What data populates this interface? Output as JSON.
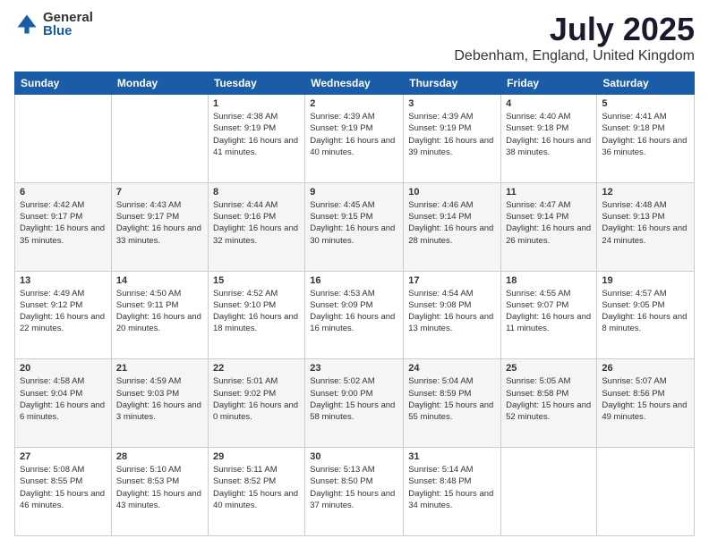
{
  "logo": {
    "general": "General",
    "blue": "Blue"
  },
  "title": {
    "month": "July 2025",
    "location": "Debenham, England, United Kingdom"
  },
  "headers": [
    "Sunday",
    "Monday",
    "Tuesday",
    "Wednesday",
    "Thursday",
    "Friday",
    "Saturday"
  ],
  "weeks": [
    [
      {
        "day": "",
        "sunrise": "",
        "sunset": "",
        "daylight": ""
      },
      {
        "day": "",
        "sunrise": "",
        "sunset": "",
        "daylight": ""
      },
      {
        "day": "1",
        "sunrise": "Sunrise: 4:38 AM",
        "sunset": "Sunset: 9:19 PM",
        "daylight": "Daylight: 16 hours and 41 minutes."
      },
      {
        "day": "2",
        "sunrise": "Sunrise: 4:39 AM",
        "sunset": "Sunset: 9:19 PM",
        "daylight": "Daylight: 16 hours and 40 minutes."
      },
      {
        "day": "3",
        "sunrise": "Sunrise: 4:39 AM",
        "sunset": "Sunset: 9:19 PM",
        "daylight": "Daylight: 16 hours and 39 minutes."
      },
      {
        "day": "4",
        "sunrise": "Sunrise: 4:40 AM",
        "sunset": "Sunset: 9:18 PM",
        "daylight": "Daylight: 16 hours and 38 minutes."
      },
      {
        "day": "5",
        "sunrise": "Sunrise: 4:41 AM",
        "sunset": "Sunset: 9:18 PM",
        "daylight": "Daylight: 16 hours and 36 minutes."
      }
    ],
    [
      {
        "day": "6",
        "sunrise": "Sunrise: 4:42 AM",
        "sunset": "Sunset: 9:17 PM",
        "daylight": "Daylight: 16 hours and 35 minutes."
      },
      {
        "day": "7",
        "sunrise": "Sunrise: 4:43 AM",
        "sunset": "Sunset: 9:17 PM",
        "daylight": "Daylight: 16 hours and 33 minutes."
      },
      {
        "day": "8",
        "sunrise": "Sunrise: 4:44 AM",
        "sunset": "Sunset: 9:16 PM",
        "daylight": "Daylight: 16 hours and 32 minutes."
      },
      {
        "day": "9",
        "sunrise": "Sunrise: 4:45 AM",
        "sunset": "Sunset: 9:15 PM",
        "daylight": "Daylight: 16 hours and 30 minutes."
      },
      {
        "day": "10",
        "sunrise": "Sunrise: 4:46 AM",
        "sunset": "Sunset: 9:14 PM",
        "daylight": "Daylight: 16 hours and 28 minutes."
      },
      {
        "day": "11",
        "sunrise": "Sunrise: 4:47 AM",
        "sunset": "Sunset: 9:14 PM",
        "daylight": "Daylight: 16 hours and 26 minutes."
      },
      {
        "day": "12",
        "sunrise": "Sunrise: 4:48 AM",
        "sunset": "Sunset: 9:13 PM",
        "daylight": "Daylight: 16 hours and 24 minutes."
      }
    ],
    [
      {
        "day": "13",
        "sunrise": "Sunrise: 4:49 AM",
        "sunset": "Sunset: 9:12 PM",
        "daylight": "Daylight: 16 hours and 22 minutes."
      },
      {
        "day": "14",
        "sunrise": "Sunrise: 4:50 AM",
        "sunset": "Sunset: 9:11 PM",
        "daylight": "Daylight: 16 hours and 20 minutes."
      },
      {
        "day": "15",
        "sunrise": "Sunrise: 4:52 AM",
        "sunset": "Sunset: 9:10 PM",
        "daylight": "Daylight: 16 hours and 18 minutes."
      },
      {
        "day": "16",
        "sunrise": "Sunrise: 4:53 AM",
        "sunset": "Sunset: 9:09 PM",
        "daylight": "Daylight: 16 hours and 16 minutes."
      },
      {
        "day": "17",
        "sunrise": "Sunrise: 4:54 AM",
        "sunset": "Sunset: 9:08 PM",
        "daylight": "Daylight: 16 hours and 13 minutes."
      },
      {
        "day": "18",
        "sunrise": "Sunrise: 4:55 AM",
        "sunset": "Sunset: 9:07 PM",
        "daylight": "Daylight: 16 hours and 11 minutes."
      },
      {
        "day": "19",
        "sunrise": "Sunrise: 4:57 AM",
        "sunset": "Sunset: 9:05 PM",
        "daylight": "Daylight: 16 hours and 8 minutes."
      }
    ],
    [
      {
        "day": "20",
        "sunrise": "Sunrise: 4:58 AM",
        "sunset": "Sunset: 9:04 PM",
        "daylight": "Daylight: 16 hours and 6 minutes."
      },
      {
        "day": "21",
        "sunrise": "Sunrise: 4:59 AM",
        "sunset": "Sunset: 9:03 PM",
        "daylight": "Daylight: 16 hours and 3 minutes."
      },
      {
        "day": "22",
        "sunrise": "Sunrise: 5:01 AM",
        "sunset": "Sunset: 9:02 PM",
        "daylight": "Daylight: 16 hours and 0 minutes."
      },
      {
        "day": "23",
        "sunrise": "Sunrise: 5:02 AM",
        "sunset": "Sunset: 9:00 PM",
        "daylight": "Daylight: 15 hours and 58 minutes."
      },
      {
        "day": "24",
        "sunrise": "Sunrise: 5:04 AM",
        "sunset": "Sunset: 8:59 PM",
        "daylight": "Daylight: 15 hours and 55 minutes."
      },
      {
        "day": "25",
        "sunrise": "Sunrise: 5:05 AM",
        "sunset": "Sunset: 8:58 PM",
        "daylight": "Daylight: 15 hours and 52 minutes."
      },
      {
        "day": "26",
        "sunrise": "Sunrise: 5:07 AM",
        "sunset": "Sunset: 8:56 PM",
        "daylight": "Daylight: 15 hours and 49 minutes."
      }
    ],
    [
      {
        "day": "27",
        "sunrise": "Sunrise: 5:08 AM",
        "sunset": "Sunset: 8:55 PM",
        "daylight": "Daylight: 15 hours and 46 minutes."
      },
      {
        "day": "28",
        "sunrise": "Sunrise: 5:10 AM",
        "sunset": "Sunset: 8:53 PM",
        "daylight": "Daylight: 15 hours and 43 minutes."
      },
      {
        "day": "29",
        "sunrise": "Sunrise: 5:11 AM",
        "sunset": "Sunset: 8:52 PM",
        "daylight": "Daylight: 15 hours and 40 minutes."
      },
      {
        "day": "30",
        "sunrise": "Sunrise: 5:13 AM",
        "sunset": "Sunset: 8:50 PM",
        "daylight": "Daylight: 15 hours and 37 minutes."
      },
      {
        "day": "31",
        "sunrise": "Sunrise: 5:14 AM",
        "sunset": "Sunset: 8:48 PM",
        "daylight": "Daylight: 15 hours and 34 minutes."
      },
      {
        "day": "",
        "sunrise": "",
        "sunset": "",
        "daylight": ""
      },
      {
        "day": "",
        "sunrise": "",
        "sunset": "",
        "daylight": ""
      }
    ]
  ]
}
